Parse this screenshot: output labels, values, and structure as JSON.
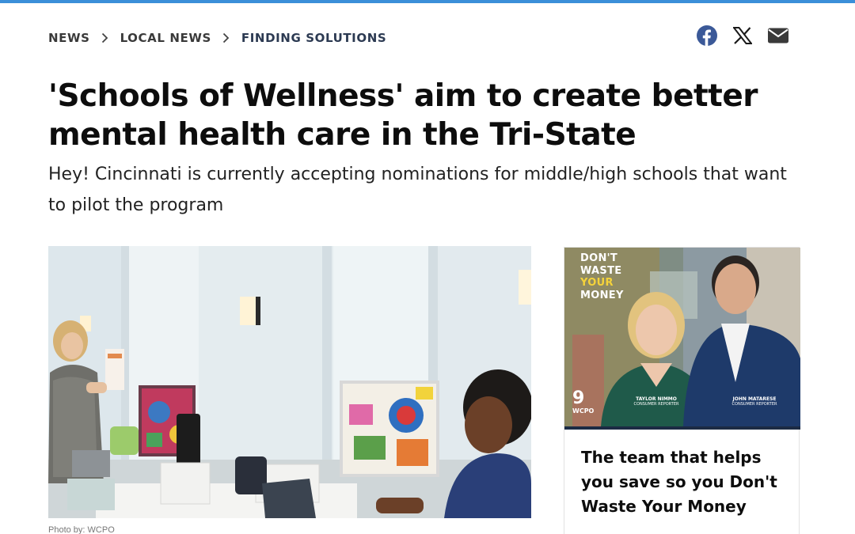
{
  "breadcrumb": {
    "items": [
      "NEWS",
      "LOCAL NEWS",
      "FINDING SOLUTIONS"
    ]
  },
  "share": {
    "icons": [
      "facebook-icon",
      "x-icon",
      "email-icon"
    ],
    "facebook_color": "#3b5998"
  },
  "article": {
    "headline": "'Schools of Wellness' aim to create better mental health care in the Tri-State",
    "subheadline": "Hey! Cincinnati is currently accepting nominations for middle/high schools that want to pilot the program",
    "photo_credit": "Photo by: WCPO"
  },
  "promo": {
    "logo_lines": [
      "DON'T",
      "WASTE",
      "YOUR",
      "MONEY"
    ],
    "person1_name": "TAYLOR NIMMO",
    "person1_role": "CONSUMER REPORTER",
    "person2_name": "JOHN MATARESE",
    "person2_role": "CONSUMER REPORTER",
    "station_number": "9",
    "station_call": "WCPO",
    "title": "The team that helps you save so you Don't Waste Your Money"
  },
  "colors": {
    "accent_bar": "#3b8fd9",
    "text": "#0d0d0d",
    "breadcrumb": "#3a3a3a",
    "breadcrumb_current": "#2c3a52"
  }
}
